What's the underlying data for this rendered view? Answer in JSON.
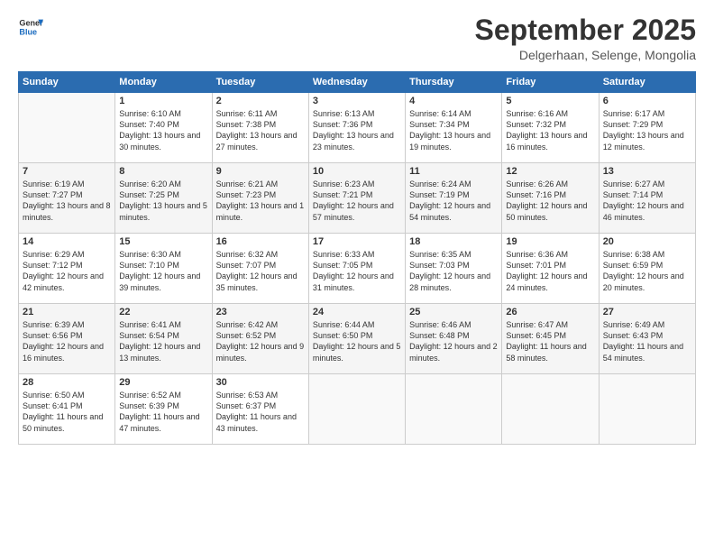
{
  "header": {
    "logo_line1": "General",
    "logo_line2": "Blue",
    "month": "September 2025",
    "location": "Delgerhaan, Selenge, Mongolia"
  },
  "weekdays": [
    "Sunday",
    "Monday",
    "Tuesday",
    "Wednesday",
    "Thursday",
    "Friday",
    "Saturday"
  ],
  "weeks": [
    [
      {
        "day": "",
        "sunrise": "",
        "sunset": "",
        "daylight": ""
      },
      {
        "day": "1",
        "sunrise": "Sunrise: 6:10 AM",
        "sunset": "Sunset: 7:40 PM",
        "daylight": "Daylight: 13 hours and 30 minutes."
      },
      {
        "day": "2",
        "sunrise": "Sunrise: 6:11 AM",
        "sunset": "Sunset: 7:38 PM",
        "daylight": "Daylight: 13 hours and 27 minutes."
      },
      {
        "day": "3",
        "sunrise": "Sunrise: 6:13 AM",
        "sunset": "Sunset: 7:36 PM",
        "daylight": "Daylight: 13 hours and 23 minutes."
      },
      {
        "day": "4",
        "sunrise": "Sunrise: 6:14 AM",
        "sunset": "Sunset: 7:34 PM",
        "daylight": "Daylight: 13 hours and 19 minutes."
      },
      {
        "day": "5",
        "sunrise": "Sunrise: 6:16 AM",
        "sunset": "Sunset: 7:32 PM",
        "daylight": "Daylight: 13 hours and 16 minutes."
      },
      {
        "day": "6",
        "sunrise": "Sunrise: 6:17 AM",
        "sunset": "Sunset: 7:29 PM",
        "daylight": "Daylight: 13 hours and 12 minutes."
      }
    ],
    [
      {
        "day": "7",
        "sunrise": "Sunrise: 6:19 AM",
        "sunset": "Sunset: 7:27 PM",
        "daylight": "Daylight: 13 hours and 8 minutes."
      },
      {
        "day": "8",
        "sunrise": "Sunrise: 6:20 AM",
        "sunset": "Sunset: 7:25 PM",
        "daylight": "Daylight: 13 hours and 5 minutes."
      },
      {
        "day": "9",
        "sunrise": "Sunrise: 6:21 AM",
        "sunset": "Sunset: 7:23 PM",
        "daylight": "Daylight: 13 hours and 1 minute."
      },
      {
        "day": "10",
        "sunrise": "Sunrise: 6:23 AM",
        "sunset": "Sunset: 7:21 PM",
        "daylight": "Daylight: 12 hours and 57 minutes."
      },
      {
        "day": "11",
        "sunrise": "Sunrise: 6:24 AM",
        "sunset": "Sunset: 7:19 PM",
        "daylight": "Daylight: 12 hours and 54 minutes."
      },
      {
        "day": "12",
        "sunrise": "Sunrise: 6:26 AM",
        "sunset": "Sunset: 7:16 PM",
        "daylight": "Daylight: 12 hours and 50 minutes."
      },
      {
        "day": "13",
        "sunrise": "Sunrise: 6:27 AM",
        "sunset": "Sunset: 7:14 PM",
        "daylight": "Daylight: 12 hours and 46 minutes."
      }
    ],
    [
      {
        "day": "14",
        "sunrise": "Sunrise: 6:29 AM",
        "sunset": "Sunset: 7:12 PM",
        "daylight": "Daylight: 12 hours and 42 minutes."
      },
      {
        "day": "15",
        "sunrise": "Sunrise: 6:30 AM",
        "sunset": "Sunset: 7:10 PM",
        "daylight": "Daylight: 12 hours and 39 minutes."
      },
      {
        "day": "16",
        "sunrise": "Sunrise: 6:32 AM",
        "sunset": "Sunset: 7:07 PM",
        "daylight": "Daylight: 12 hours and 35 minutes."
      },
      {
        "day": "17",
        "sunrise": "Sunrise: 6:33 AM",
        "sunset": "Sunset: 7:05 PM",
        "daylight": "Daylight: 12 hours and 31 minutes."
      },
      {
        "day": "18",
        "sunrise": "Sunrise: 6:35 AM",
        "sunset": "Sunset: 7:03 PM",
        "daylight": "Daylight: 12 hours and 28 minutes."
      },
      {
        "day": "19",
        "sunrise": "Sunrise: 6:36 AM",
        "sunset": "Sunset: 7:01 PM",
        "daylight": "Daylight: 12 hours and 24 minutes."
      },
      {
        "day": "20",
        "sunrise": "Sunrise: 6:38 AM",
        "sunset": "Sunset: 6:59 PM",
        "daylight": "Daylight: 12 hours and 20 minutes."
      }
    ],
    [
      {
        "day": "21",
        "sunrise": "Sunrise: 6:39 AM",
        "sunset": "Sunset: 6:56 PM",
        "daylight": "Daylight: 12 hours and 16 minutes."
      },
      {
        "day": "22",
        "sunrise": "Sunrise: 6:41 AM",
        "sunset": "Sunset: 6:54 PM",
        "daylight": "Daylight: 12 hours and 13 minutes."
      },
      {
        "day": "23",
        "sunrise": "Sunrise: 6:42 AM",
        "sunset": "Sunset: 6:52 PM",
        "daylight": "Daylight: 12 hours and 9 minutes."
      },
      {
        "day": "24",
        "sunrise": "Sunrise: 6:44 AM",
        "sunset": "Sunset: 6:50 PM",
        "daylight": "Daylight: 12 hours and 5 minutes."
      },
      {
        "day": "25",
        "sunrise": "Sunrise: 6:46 AM",
        "sunset": "Sunset: 6:48 PM",
        "daylight": "Daylight: 12 hours and 2 minutes."
      },
      {
        "day": "26",
        "sunrise": "Sunrise: 6:47 AM",
        "sunset": "Sunset: 6:45 PM",
        "daylight": "Daylight: 11 hours and 58 minutes."
      },
      {
        "day": "27",
        "sunrise": "Sunrise: 6:49 AM",
        "sunset": "Sunset: 6:43 PM",
        "daylight": "Daylight: 11 hours and 54 minutes."
      }
    ],
    [
      {
        "day": "28",
        "sunrise": "Sunrise: 6:50 AM",
        "sunset": "Sunset: 6:41 PM",
        "daylight": "Daylight: 11 hours and 50 minutes."
      },
      {
        "day": "29",
        "sunrise": "Sunrise: 6:52 AM",
        "sunset": "Sunset: 6:39 PM",
        "daylight": "Daylight: 11 hours and 47 minutes."
      },
      {
        "day": "30",
        "sunrise": "Sunrise: 6:53 AM",
        "sunset": "Sunset: 6:37 PM",
        "daylight": "Daylight: 11 hours and 43 minutes."
      },
      {
        "day": "",
        "sunrise": "",
        "sunset": "",
        "daylight": ""
      },
      {
        "day": "",
        "sunrise": "",
        "sunset": "",
        "daylight": ""
      },
      {
        "day": "",
        "sunrise": "",
        "sunset": "",
        "daylight": ""
      },
      {
        "day": "",
        "sunrise": "",
        "sunset": "",
        "daylight": ""
      }
    ]
  ]
}
